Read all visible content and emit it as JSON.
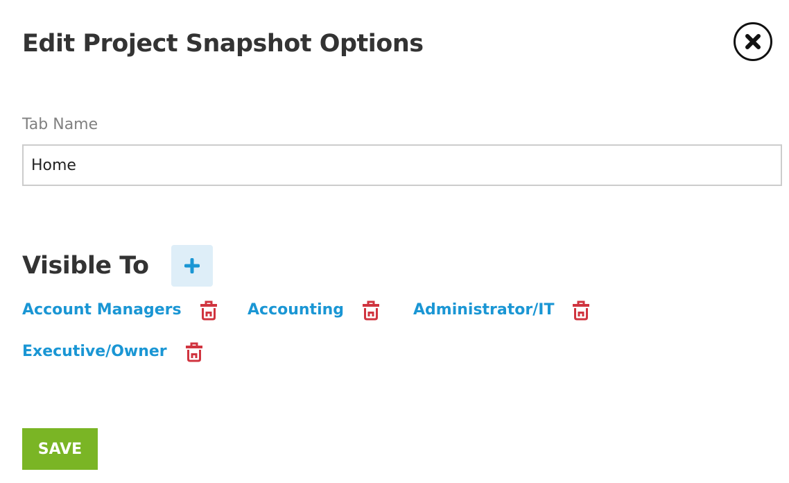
{
  "dialog": {
    "title": "Edit Project Snapshot Options",
    "close_icon": "close-circle-icon"
  },
  "tab_name": {
    "label": "Tab Name",
    "value": "Home",
    "placeholder": ""
  },
  "visible_to": {
    "title": "Visible To",
    "add_icon": "plus-icon",
    "remove_icon": "trash-icon",
    "roles": [
      {
        "name": "Account Managers"
      },
      {
        "name": "Accounting"
      },
      {
        "name": "Administrator/IT"
      },
      {
        "name": "Executive/Owner"
      }
    ]
  },
  "footer": {
    "save_label": "SAVE"
  },
  "colors": {
    "title": "#333333",
    "link": "#1a96d4",
    "delete": "#d0343f",
    "save_bg": "#7ab525",
    "add_bg": "#deeef8",
    "label": "#808080"
  }
}
